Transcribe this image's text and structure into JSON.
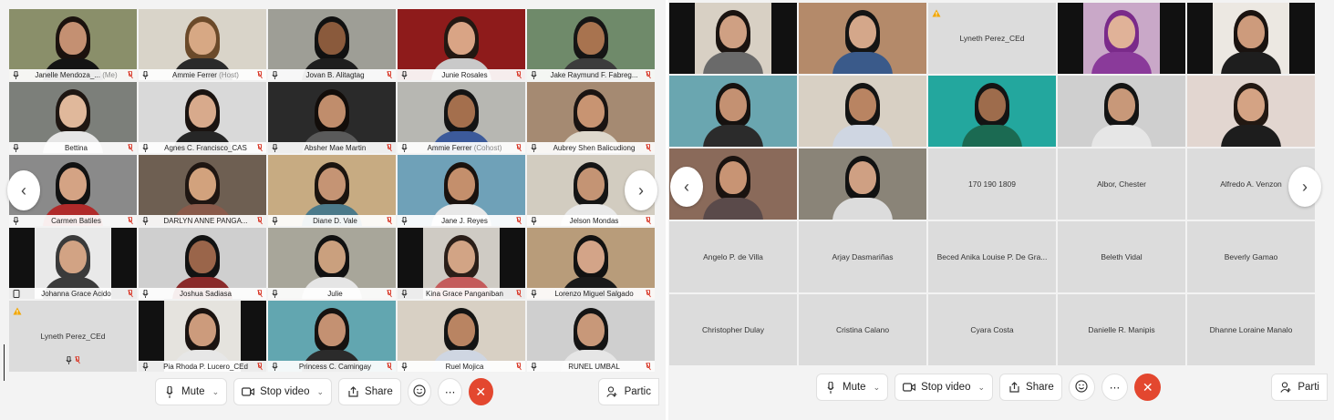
{
  "left": {
    "tiles": [
      {
        "name": "Janelle Mendoza_...",
        "suffix": "(Me)",
        "kind": "video",
        "selected": true,
        "bg": "#8a8f6a",
        "skin": "#c49072",
        "hair": "#1b120e",
        "shirt": "#141414"
      },
      {
        "name": "Ammie Ferrer",
        "suffix": "(Host)",
        "kind": "video",
        "bg": "#d9d4c9",
        "skin": "#d7a884",
        "hair": "#6b4a2a",
        "shirt": "#2a2a2a"
      },
      {
        "name": "Jovan B. Alitagtag",
        "suffix": "",
        "kind": "video",
        "bg": "#9e9e96",
        "skin": "#8a5a3c",
        "hair": "#111",
        "shirt": "#1e1e1e"
      },
      {
        "name": "Junie Rosales",
        "suffix": "",
        "kind": "video",
        "bg": "#8e1b1b",
        "skin": "#d9a485",
        "hair": "#231812",
        "shirt": "#c9c9c9"
      },
      {
        "name": "Jake Raymund F. Fabreg...",
        "suffix": "",
        "kind": "video",
        "bg": "#6f8a6a",
        "skin": "#a8734f",
        "hair": "#151515",
        "shirt": "#3c3c3c"
      },
      {
        "name": "Bettina",
        "suffix": "",
        "kind": "video",
        "bg": "#7c7f7a",
        "skin": "#e0b89b",
        "hair": "#1e1612",
        "shirt": "#e6e6e6"
      },
      {
        "name": "Agnes C. Francisco_CAS",
        "suffix": "",
        "kind": "video",
        "bg": "#d9d9d9",
        "skin": "#d8aa8c",
        "hair": "#1a1310",
        "shirt": "#262626"
      },
      {
        "name": "Absher Mae Martin",
        "suffix": "",
        "kind": "video",
        "bg": "#2a2a2a",
        "skin": "#c08d6c",
        "hair": "#120d0a",
        "shirt": "#5a5a5a"
      },
      {
        "name": "Ammie Ferrer",
        "suffix": "(Cohost)",
        "kind": "video",
        "bg": "#b7b7b2",
        "skin": "#a46f4d",
        "hair": "#141414",
        "shirt": "#3c5a9a"
      },
      {
        "name": "Aubrey Shen Balicudiong",
        "suffix": "",
        "kind": "video",
        "bg": "#a58a72",
        "skin": "#c89472",
        "hair": "#1a1412",
        "shirt": "#ded8cc"
      },
      {
        "name": "Carmen Batiles",
        "suffix": "",
        "kind": "video",
        "bg": "#8a8a8a",
        "skin": "#d4a384",
        "hair": "#121212",
        "shirt": "#b02a2a"
      },
      {
        "name": "DARLYN ANNE PANGA...",
        "suffix": "",
        "kind": "video",
        "bg": "#6e5f52",
        "skin": "#d2a27d",
        "hair": "#1f1612",
        "shirt": "#8a5a4a"
      },
      {
        "name": "Diane D. Vale",
        "suffix": "",
        "kind": "video",
        "bg": "#c7ab82",
        "skin": "#c59474",
        "hair": "#1b140f",
        "shirt": "#4b7a8a"
      },
      {
        "name": "Jane J. Reyes",
        "suffix": "",
        "kind": "video",
        "bg": "#6fa1b8",
        "skin": "#c48f6c",
        "hair": "#1a120e",
        "shirt": "#e8e8e8"
      },
      {
        "name": "Jelson Mondas",
        "suffix": "",
        "kind": "video",
        "bg": "#d2ccc0",
        "skin": "#c49474",
        "hair": "#151515",
        "shirt": "#e9e9e9"
      },
      {
        "name": "Johanna Grace Acido",
        "suffix": "",
        "kind": "video",
        "bars": true,
        "bg": "#e9e9e9",
        "skin": "#d2a384",
        "hair": "#3a3a3a",
        "shirt": "#3b3b3b"
      },
      {
        "name": "Joshua Sadiasa",
        "suffix": "",
        "kind": "video",
        "bg": "#cfcfcf",
        "skin": "#9a654a",
        "hair": "#121212",
        "shirt": "#8a2a2a"
      },
      {
        "name": "Julie",
        "suffix": "",
        "kind": "video",
        "bg": "#a8a69a",
        "skin": "#caa07e",
        "hair": "#111",
        "shirt": "#e5e5e5"
      },
      {
        "name": "Kina Grace Panganiban",
        "suffix": "",
        "kind": "video",
        "bars": true,
        "bg": "#cfcbc4",
        "skin": "#d2a485",
        "hair": "#2a1e18",
        "shirt": "#c45b5b"
      },
      {
        "name": "Lorenzo Miguel Salgado",
        "suffix": "",
        "kind": "video",
        "bg": "#b89c7a",
        "skin": "#d3a488",
        "hair": "#121212",
        "shirt": "#1a1a1a"
      },
      {
        "name": "Lyneth Perez_CEd",
        "suffix": "",
        "kind": "audio",
        "bg": "#dcdcdc"
      },
      {
        "name": "Pia Rhoda P. Lucero_CEd",
        "suffix": "",
        "kind": "video",
        "bars": true,
        "bg": "#e5e3de",
        "skin": "#cc9b7c",
        "hair": "#1a1310",
        "shirt": "#e7e7e7"
      },
      {
        "name": "Princess C. Camingay",
        "suffix": "",
        "kind": "video",
        "bg": "#62a6b0",
        "skin": "#c49172",
        "hair": "#161210",
        "shirt": "#2b2b2b"
      },
      {
        "name": "Ruel Mojica",
        "suffix": "",
        "kind": "video",
        "bg": "#d8d0c4",
        "skin": "#b98462",
        "hair": "#141414",
        "shirt": "#cfd6e2"
      },
      {
        "name": "RUNEL UMBAL",
        "suffix": "",
        "kind": "video",
        "bg": "#cfcfcf",
        "skin": "#c89879",
        "hair": "#141414",
        "shirt": "#e6e6e6"
      }
    ],
    "toolbar": {
      "mute": "Mute",
      "stop_video": "Stop video",
      "share": "Share",
      "participants": "Partic"
    }
  },
  "right": {
    "tiles": [
      {
        "name": "",
        "kind": "video",
        "bars": true,
        "bg": "#d8d0c4",
        "skin": "#cfa083",
        "hair": "#1a1310",
        "shirt": "#6a6a6a"
      },
      {
        "name": "",
        "kind": "video",
        "bg": "#b48a6a",
        "skin": "#d4a78a",
        "hair": "#141414",
        "shirt": "#3a5a8a"
      },
      {
        "name": "Lyneth Perez_CEd",
        "kind": "audio-warn"
      },
      {
        "name": "",
        "kind": "video",
        "bars": true,
        "bg": "#c9a8c8",
        "skin": "#e0b298",
        "hair": "#7a2a8a",
        "shirt": "#8a3a9a"
      },
      {
        "name": "",
        "kind": "video",
        "bars": true,
        "bg": "#ece8e2",
        "skin": "#cd9b7c",
        "hair": "#1a1310",
        "shirt": "#1e1e1e"
      },
      {
        "name": "",
        "kind": "video",
        "bg": "#6aa6b0",
        "skin": "#c49172",
        "hair": "#161210",
        "shirt": "#2b2b2b"
      },
      {
        "name": "",
        "kind": "video",
        "bg": "#d8d0c4",
        "skin": "#b98462",
        "hair": "#141414",
        "shirt": "#cfd6e2"
      },
      {
        "name": "",
        "kind": "video",
        "bg": "#23a79e",
        "skin": "#9e6c4c",
        "hair": "#141414",
        "shirt": "#1b6a52"
      },
      {
        "name": "",
        "kind": "video",
        "bg": "#cfcfcf",
        "skin": "#c89879",
        "hair": "#141414",
        "shirt": "#e6e6e6"
      },
      {
        "name": "",
        "kind": "video",
        "bg": "#e2d6d0",
        "skin": "#d4a384",
        "hair": "#221812",
        "shirt": "#1d1d1d"
      },
      {
        "name": "",
        "kind": "video",
        "bg": "#8a6a5a",
        "skin": "#c89474",
        "hair": "#1a1310",
        "shirt": "#5a4a4a"
      },
      {
        "name": "",
        "kind": "video",
        "bg": "#8a8478",
        "skin": "#cfa083",
        "hair": "#121212",
        "shirt": "#dcdcdc"
      },
      {
        "name": "170 190 1809",
        "kind": "audio"
      },
      {
        "name": "Albor, Chester",
        "kind": "audio"
      },
      {
        "name": "Alfredo A. Venzon",
        "kind": "audio"
      },
      {
        "name": "Angelo P. de Villa",
        "kind": "audio"
      },
      {
        "name": "Arjay Dasmariñas",
        "kind": "audio"
      },
      {
        "name": "Beced Anika Louise P. De Gra...",
        "kind": "audio"
      },
      {
        "name": "Beleth Vidal",
        "kind": "audio"
      },
      {
        "name": "Beverly Gamao",
        "kind": "audio"
      },
      {
        "name": "Christopher Dulay",
        "kind": "audio"
      },
      {
        "name": "Cristina Calano",
        "kind": "audio"
      },
      {
        "name": "Cyara Costa",
        "kind": "audio"
      },
      {
        "name": "Danielle R. Manipis",
        "kind": "audio"
      },
      {
        "name": "Dhanne Loraine Manalo",
        "kind": "audio"
      }
    ],
    "toolbar": {
      "mute": "Mute",
      "stop_video": "Stop video",
      "share": "Share",
      "participants": "Parti"
    }
  },
  "icons": {
    "mic": "microphone-icon",
    "mic_muted": "microphone-muted-icon",
    "phone": "phone-icon",
    "warning": "warning-icon",
    "video": "video-camera-icon",
    "share": "share-icon",
    "reactions": "emoji-icon",
    "more": "more-icon",
    "end": "end-call-icon",
    "participants": "participants-icon",
    "next": "chevron-right-icon",
    "prev": "chevron-left-icon"
  },
  "colors": {
    "end_call": "#e3472f",
    "muted_icon": "#d93b2b",
    "selected_border": "#35a7e8",
    "warning": "#f2a600"
  }
}
